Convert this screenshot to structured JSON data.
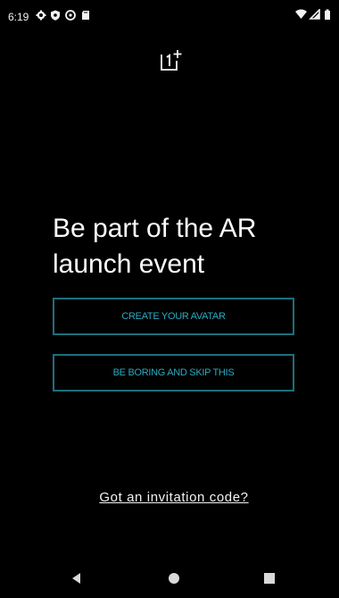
{
  "status_bar": {
    "time": "6:19",
    "left_icons": [
      "settings-icon",
      "shield-icon",
      "at-sign-icon",
      "sd-card-icon"
    ],
    "right_icons": [
      "wifi-icon",
      "signal-icon",
      "battery-icon"
    ]
  },
  "logo": {
    "icon": "oneplus-logo-icon",
    "text": "1+"
  },
  "main": {
    "heading": "Be part of the AR launch event",
    "buttons": {
      "create_avatar": "CREATE YOUR AVATAR",
      "skip": "BE BORING AND SKIP THIS"
    },
    "invite_link": "Got an invitation code?"
  },
  "nav_bar": {
    "items": [
      "back-icon",
      "home-icon",
      "recents-icon"
    ]
  },
  "colors": {
    "background": "#000000",
    "accent": "#2ca9bf",
    "button_border": "#1f6f7c",
    "text": "#ffffff"
  }
}
